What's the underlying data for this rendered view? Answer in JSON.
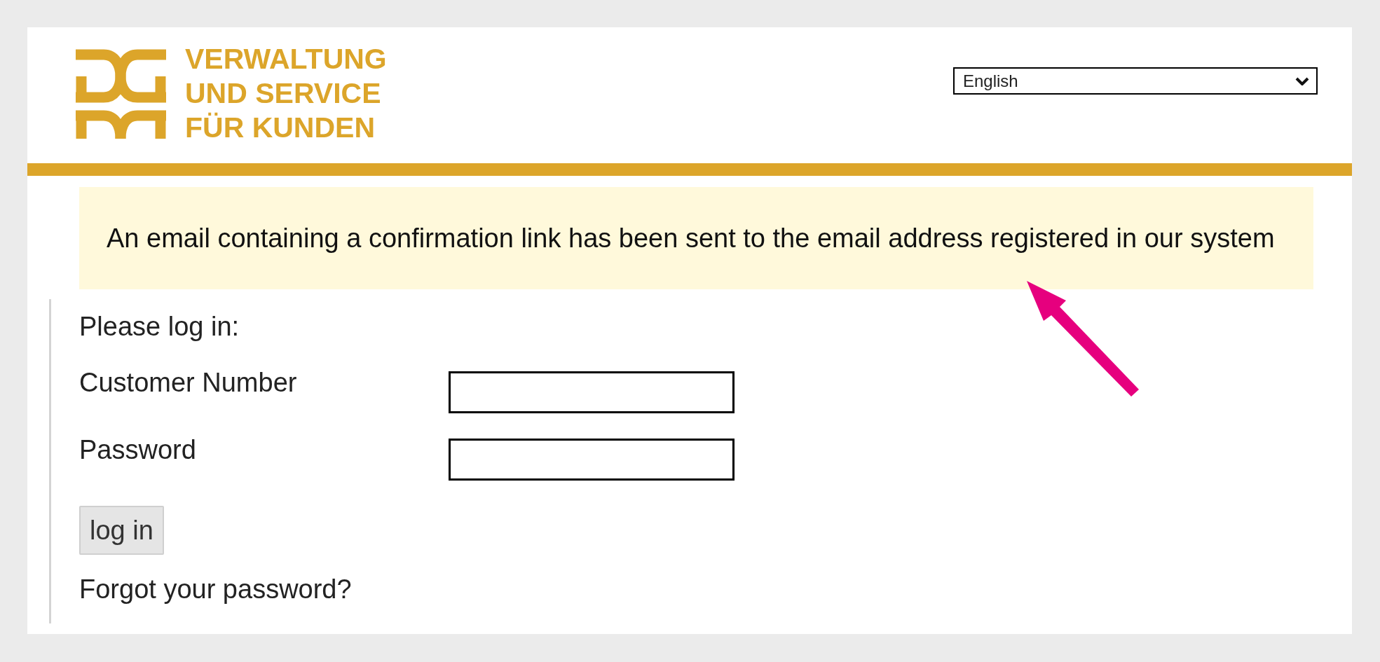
{
  "logo": {
    "lines": [
      "VERWALTUNG",
      "UND SERVICE",
      "FÜR KUNDEN"
    ]
  },
  "language_select": {
    "value": "English"
  },
  "notice": {
    "text": "An email containing a confirmation link has been sent to the email address registered in our system"
  },
  "login_form": {
    "heading": "Please log in:",
    "fields": [
      {
        "label": "Customer Number"
      },
      {
        "label": "Password"
      }
    ],
    "button": "log in",
    "forgot_link": "Forgot your password?"
  }
}
